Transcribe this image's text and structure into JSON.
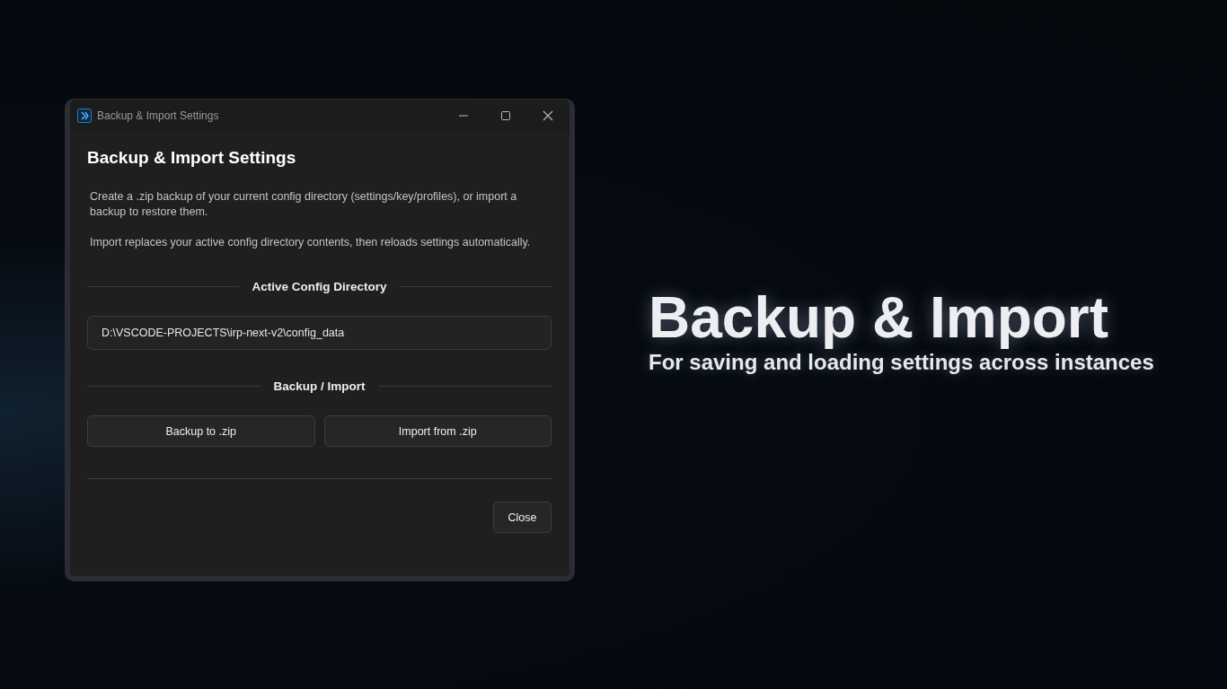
{
  "window": {
    "title": "Backup & Import Settings"
  },
  "heading": "Backup & Import Settings",
  "paragraphs": [
    "Create a .zip backup of your current config directory (settings/key/profiles), or import a backup to restore them.",
    "Import replaces your active config directory contents, then reloads settings automatically."
  ],
  "config_section": {
    "title": "Active Config Directory",
    "path": "D:\\VSCODE-PROJECTS\\irp-next-v2\\config_data"
  },
  "backup_section": {
    "title": "Backup / Import",
    "buttons": [
      "Backup to .zip",
      "Import from .zip"
    ]
  },
  "close_button": "Close",
  "promo": {
    "title": "Backup & Import",
    "subtitle": "For saving and loading settings across instances"
  }
}
